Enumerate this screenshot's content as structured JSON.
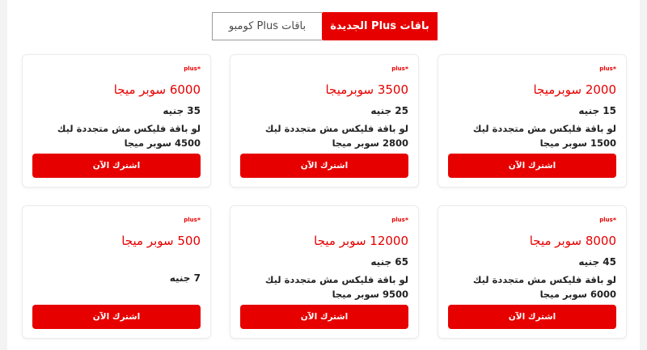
{
  "tabs": [
    {
      "label": "باقات Plus الجديدة",
      "active": true
    },
    {
      "label": "باقات Plus كومبو",
      "active": false
    }
  ],
  "badge": "plus",
  "cards": [
    {
      "title": "2000 سوبرميجا",
      "price": "15 جنيه",
      "desc": "لو باقة فليكس مش متجددة ليك 1500 سوبر ميجا",
      "button": "اشترك الآن"
    },
    {
      "title": "3500 سوبرميجا",
      "price": "25 جنيه",
      "desc": "لو باقة فليكس مش متجددة ليك 2800 سوبر ميجا",
      "button": "اشترك الآن"
    },
    {
      "title": "6000 سوبر ميجا",
      "price": "35 جنيه",
      "desc": "لو باقة فليكس مش متجددة ليك 4500 سوبر ميجا",
      "button": "اشترك الآن"
    },
    {
      "title": "8000 سوبر ميجا",
      "price": "45 جنيه",
      "desc": "لو باقة فليكس مش متجددة ليك 6000 سوبر ميجا",
      "button": "اشترك الآن"
    },
    {
      "title": "12000 سوبر ميجا",
      "price": "65 جنيه",
      "desc": "لو باقة فليكس مش متجددة ليك 9500 سوبر ميجا",
      "button": "اشترك الآن"
    },
    {
      "title": "500 سوبر ميجا",
      "price": "7 جنيه",
      "desc": "",
      "button": "اشترك الآن"
    }
  ],
  "colors": {
    "accent": "#e60000"
  }
}
